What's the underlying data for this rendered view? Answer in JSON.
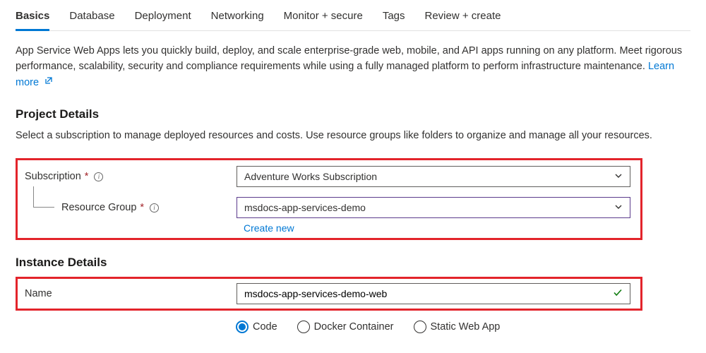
{
  "tabs": {
    "basics": "Basics",
    "database": "Database",
    "deployment": "Deployment",
    "networking": "Networking",
    "monitor": "Monitor + secure",
    "tags": "Tags",
    "review": "Review + create"
  },
  "intro": {
    "text": "App Service Web Apps lets you quickly build, deploy, and scale enterprise-grade web, mobile, and API apps running on any platform. Meet rigorous performance, scalability, security and compliance requirements while using a fully managed platform to perform infrastructure maintenance.  ",
    "learn_more": "Learn more"
  },
  "project": {
    "title": "Project Details",
    "desc": "Select a subscription to manage deployed resources and costs. Use resource groups like folders to organize and manage all your resources.",
    "subscription_label": "Subscription",
    "subscription_value": "Adventure Works Subscription",
    "resource_group_label": "Resource Group",
    "resource_group_value": "msdocs-app-services-demo",
    "create_new": "Create new"
  },
  "instance": {
    "title": "Instance Details",
    "name_label": "Name",
    "name_value": "msdocs-app-services-demo-web",
    "radio_code": "Code",
    "radio_container": "Docker Container",
    "radio_static": "Static Web App"
  }
}
